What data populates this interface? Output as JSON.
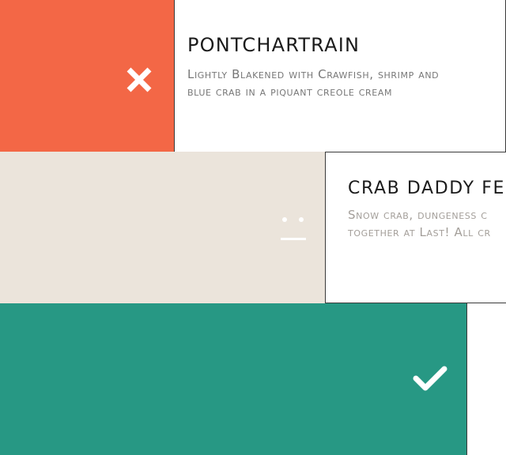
{
  "colors": {
    "reject": "#f36746",
    "neutral": "#ebe4db",
    "accept": "#279884",
    "card_background": "#ffffff"
  },
  "cards": [
    {
      "status": "reject",
      "status_icon": "close-icon",
      "title": "PONTCHARTRAIN",
      "description": "Lightly Blakened with Crawfish, shrimp and blue crab in a piquant creole cream"
    },
    {
      "status": "neutral",
      "status_icon": "neutral-face-icon",
      "title": "CRAB DADDY FE",
      "description_lines": [
        "Snow crab, dungeness c",
        "together at Last! All cr"
      ]
    },
    {
      "status": "accept",
      "status_icon": "check-icon"
    }
  ]
}
